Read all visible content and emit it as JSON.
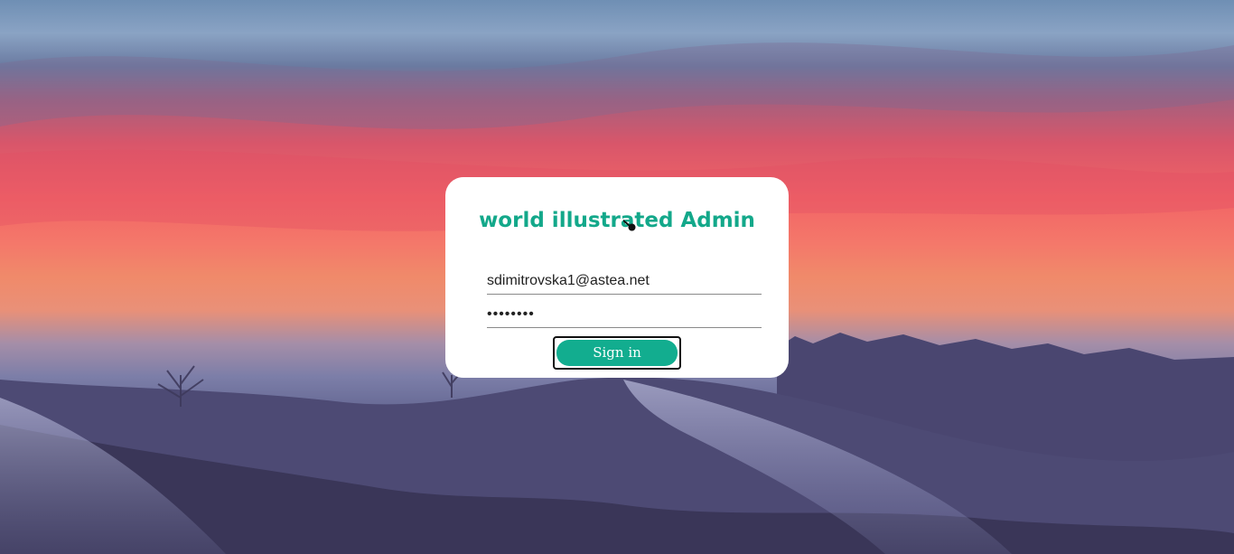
{
  "app": {
    "title": "world illustrated Admin"
  },
  "login_form": {
    "email_value": "sdimitrovska1@astea.net",
    "password_value": "••••••••",
    "signin_label": "Sign in"
  },
  "colors": {
    "brand": "#13a88a",
    "button": "#12ad8f",
    "card": "#ffffff"
  },
  "icons": {
    "cursor": "mouse-cursor-icon"
  }
}
